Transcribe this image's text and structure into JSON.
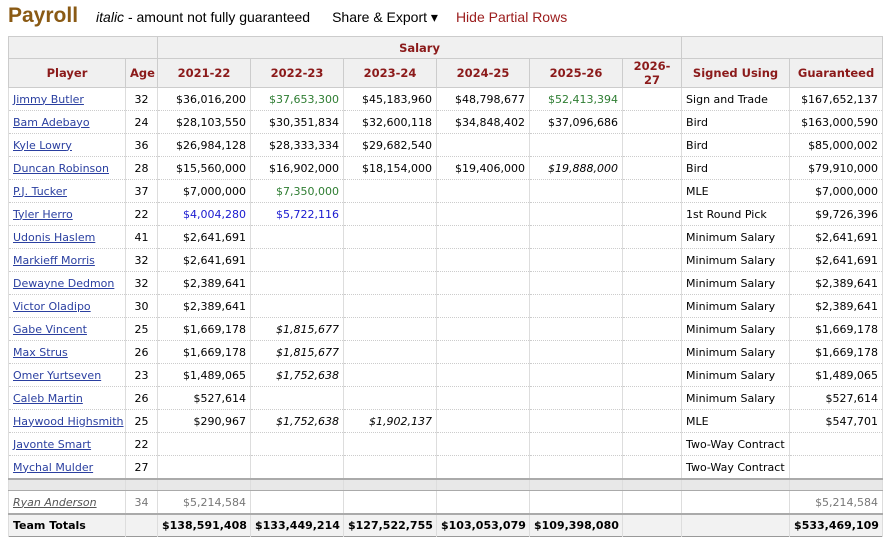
{
  "header": {
    "title": "Payroll",
    "note_italic": "italic",
    "note_rest": " - amount not fully guaranteed",
    "share": "Share & Export ▾",
    "hide": "Hide Partial Rows"
  },
  "table": {
    "group_header": "Salary",
    "columns": [
      "Player",
      "Age",
      "2021-22",
      "2022-23",
      "2023-24",
      "2024-25",
      "2025-26",
      "2026-27",
      "Signed Using",
      "Guaranteed"
    ],
    "rows": [
      {
        "player": "Jimmy Butler",
        "age": "32",
        "sal": [
          [
            "$36,016,200",
            ""
          ],
          [
            "$37,653,300",
            "green"
          ],
          [
            "$45,183,960",
            ""
          ],
          [
            "$48,798,677",
            ""
          ],
          [
            "$52,413,394",
            "green"
          ],
          [
            "",
            ""
          ]
        ],
        "signed": "Sign and Trade",
        "guar": "$167,652,137"
      },
      {
        "player": "Bam Adebayo",
        "age": "24",
        "sal": [
          [
            "$28,103,550",
            ""
          ],
          [
            "$30,351,834",
            ""
          ],
          [
            "$32,600,118",
            ""
          ],
          [
            "$34,848,402",
            ""
          ],
          [
            "$37,096,686",
            ""
          ],
          [
            "",
            ""
          ]
        ],
        "signed": "Bird",
        "guar": "$163,000,590"
      },
      {
        "player": "Kyle Lowry",
        "age": "36",
        "sal": [
          [
            "$26,984,128",
            ""
          ],
          [
            "$28,333,334",
            ""
          ],
          [
            "$29,682,540",
            ""
          ],
          [
            "",
            ""
          ],
          [
            "",
            ""
          ],
          [
            "",
            ""
          ]
        ],
        "signed": "Bird",
        "guar": "$85,000,002"
      },
      {
        "player": "Duncan Robinson",
        "age": "28",
        "sal": [
          [
            "$15,560,000",
            ""
          ],
          [
            "$16,902,000",
            ""
          ],
          [
            "$18,154,000",
            ""
          ],
          [
            "$19,406,000",
            ""
          ],
          [
            "$19,888,000",
            "italic"
          ],
          [
            "",
            ""
          ]
        ],
        "signed": "Bird",
        "guar": "$79,910,000"
      },
      {
        "player": "P.J. Tucker",
        "age": "37",
        "sal": [
          [
            "$7,000,000",
            ""
          ],
          [
            "$7,350,000",
            "green"
          ],
          [
            "",
            ""
          ],
          [
            "",
            ""
          ],
          [
            "",
            ""
          ],
          [
            "",
            ""
          ]
        ],
        "signed": "MLE",
        "guar": "$7,000,000"
      },
      {
        "player": "Tyler Herro",
        "age": "22",
        "sal": [
          [
            "$4,004,280",
            "blue"
          ],
          [
            "$5,722,116",
            "blue"
          ],
          [
            "",
            ""
          ],
          [
            "",
            ""
          ],
          [
            "",
            ""
          ],
          [
            "",
            ""
          ]
        ],
        "signed": "1st Round Pick",
        "guar": "$9,726,396"
      },
      {
        "player": "Udonis Haslem",
        "age": "41",
        "sal": [
          [
            "$2,641,691",
            ""
          ],
          [
            "",
            ""
          ],
          [
            "",
            ""
          ],
          [
            "",
            ""
          ],
          [
            "",
            ""
          ],
          [
            "",
            ""
          ]
        ],
        "signed": "Minimum Salary",
        "guar": "$2,641,691"
      },
      {
        "player": "Markieff Morris",
        "age": "32",
        "sal": [
          [
            "$2,641,691",
            ""
          ],
          [
            "",
            ""
          ],
          [
            "",
            ""
          ],
          [
            "",
            ""
          ],
          [
            "",
            ""
          ],
          [
            "",
            ""
          ]
        ],
        "signed": "Minimum Salary",
        "guar": "$2,641,691"
      },
      {
        "player": "Dewayne Dedmon",
        "age": "32",
        "sal": [
          [
            "$2,389,641",
            ""
          ],
          [
            "",
            ""
          ],
          [
            "",
            ""
          ],
          [
            "",
            ""
          ],
          [
            "",
            ""
          ],
          [
            "",
            ""
          ]
        ],
        "signed": "Minimum Salary",
        "guar": "$2,389,641"
      },
      {
        "player": "Victor Oladipo",
        "age": "30",
        "sal": [
          [
            "$2,389,641",
            ""
          ],
          [
            "",
            ""
          ],
          [
            "",
            ""
          ],
          [
            "",
            ""
          ],
          [
            "",
            ""
          ],
          [
            "",
            ""
          ]
        ],
        "signed": "Minimum Salary",
        "guar": "$2,389,641"
      },
      {
        "player": "Gabe Vincent",
        "age": "25",
        "sal": [
          [
            "$1,669,178",
            ""
          ],
          [
            "$1,815,677",
            "italic"
          ],
          [
            "",
            ""
          ],
          [
            "",
            ""
          ],
          [
            "",
            ""
          ],
          [
            "",
            ""
          ]
        ],
        "signed": "Minimum Salary",
        "guar": "$1,669,178"
      },
      {
        "player": "Max Strus",
        "age": "26",
        "sal": [
          [
            "$1,669,178",
            ""
          ],
          [
            "$1,815,677",
            "italic"
          ],
          [
            "",
            ""
          ],
          [
            "",
            ""
          ],
          [
            "",
            ""
          ],
          [
            "",
            ""
          ]
        ],
        "signed": "Minimum Salary",
        "guar": "$1,669,178"
      },
      {
        "player": "Omer Yurtseven",
        "age": "23",
        "sal": [
          [
            "$1,489,065",
            ""
          ],
          [
            "$1,752,638",
            "italic"
          ],
          [
            "",
            ""
          ],
          [
            "",
            ""
          ],
          [
            "",
            ""
          ],
          [
            "",
            ""
          ]
        ],
        "signed": "Minimum Salary",
        "guar": "$1,489,065"
      },
      {
        "player": "Caleb Martin",
        "age": "26",
        "sal": [
          [
            "$527,614",
            ""
          ],
          [
            "",
            ""
          ],
          [
            "",
            ""
          ],
          [
            "",
            ""
          ],
          [
            "",
            ""
          ],
          [
            "",
            ""
          ]
        ],
        "signed": "Minimum Salary",
        "guar": "$527,614"
      },
      {
        "player": "Haywood Highsmith",
        "age": "25",
        "sal": [
          [
            "$290,967",
            ""
          ],
          [
            "$1,752,638",
            "italic"
          ],
          [
            "$1,902,137",
            "italic"
          ],
          [
            "",
            ""
          ],
          [
            "",
            ""
          ],
          [
            "",
            ""
          ]
        ],
        "signed": "MLE",
        "guar": "$547,701"
      },
      {
        "player": "Javonte Smart",
        "age": "22",
        "sal": [
          [
            "",
            ""
          ],
          [
            "",
            ""
          ],
          [
            "",
            ""
          ],
          [
            "",
            ""
          ],
          [
            "",
            ""
          ],
          [
            "",
            ""
          ]
        ],
        "signed": "Two-Way Contract",
        "guar": ""
      },
      {
        "player": "Mychal Mulder",
        "age": "27",
        "sal": [
          [
            "",
            ""
          ],
          [
            "",
            ""
          ],
          [
            "",
            ""
          ],
          [
            "",
            ""
          ],
          [
            "",
            ""
          ],
          [
            "",
            ""
          ]
        ],
        "signed": "Two-Way Contract",
        "guar": ""
      }
    ],
    "dead": {
      "player": "Ryan Anderson",
      "age": "34",
      "sal": [
        "$5,214,584",
        "",
        "",
        "",
        "",
        ""
      ],
      "signed": "",
      "guar": "$5,214,584"
    },
    "totals": {
      "label": "Team Totals",
      "sal": [
        "$138,591,408",
        "$133,449,214",
        "$127,522,755",
        "$103,053,079",
        "$109,398,080",
        ""
      ],
      "guar": "$533,469,109"
    }
  }
}
